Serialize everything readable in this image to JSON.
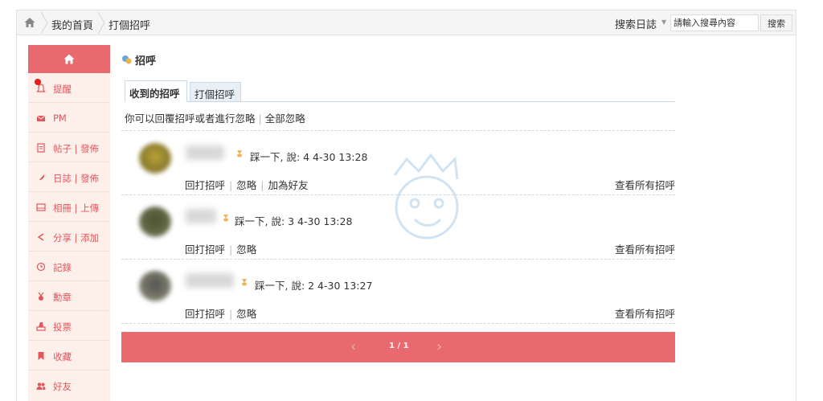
{
  "breadcrumb": {
    "home_icon": "home-icon",
    "items": [
      "我的首頁",
      "打個招呼"
    ]
  },
  "search": {
    "type_label": "搜索日誌",
    "placeholder": "請輸入搜尋內容",
    "button_label": "搜索"
  },
  "sidebar": {
    "home_icon": "home-icon",
    "items": [
      {
        "label": "提醒",
        "icon": "bell-icon"
      },
      {
        "label": "PM",
        "icon": "mail-icon"
      },
      {
        "label": "帖子 | 發佈",
        "icon": "document-icon"
      },
      {
        "label": "日誌 | 發佈",
        "icon": "feather-icon"
      },
      {
        "label": "相冊 | 上傳",
        "icon": "album-icon"
      },
      {
        "label": "分享 | 添加",
        "icon": "share-icon"
      },
      {
        "label": "記錄",
        "icon": "clock-icon"
      },
      {
        "label": "勳章",
        "icon": "medal-icon"
      },
      {
        "label": "投票",
        "icon": "vote-icon"
      },
      {
        "label": "收藏",
        "icon": "bookmark-icon"
      },
      {
        "label": "好友",
        "icon": "friends-icon"
      }
    ]
  },
  "page": {
    "title": "招呼",
    "tabs": [
      {
        "label": "收到的招呼",
        "active": true
      },
      {
        "label": "打個招呼",
        "active": false
      }
    ],
    "hint": {
      "text": "你可以回覆招呼或者進行忽略",
      "sep": "|",
      "ignore_all": "全部忽略"
    }
  },
  "greetings": [
    {
      "text": "踩一下, 說: 4  4-30 13:28",
      "actions": [
        "回打招呼",
        "忽略",
        "加為好友"
      ],
      "view_all": "查看所有招呼"
    },
    {
      "text": "踩一下, 說: 3  4-30 13:28",
      "actions": [
        "回打招呼",
        "忽略"
      ],
      "view_all": "查看所有招呼"
    },
    {
      "text": "踩一下, 說: 2  4-30 13:27",
      "actions": [
        "回打招呼",
        "忽略"
      ],
      "view_all": "查看所有招呼"
    }
  ],
  "pager": {
    "label": "1 / 1"
  },
  "colors": {
    "accent": "#e8696e",
    "sidebar_bg": "#fdf0ea",
    "sidebar_text": "#e2575d",
    "tab_border": "#c6d9e8"
  }
}
